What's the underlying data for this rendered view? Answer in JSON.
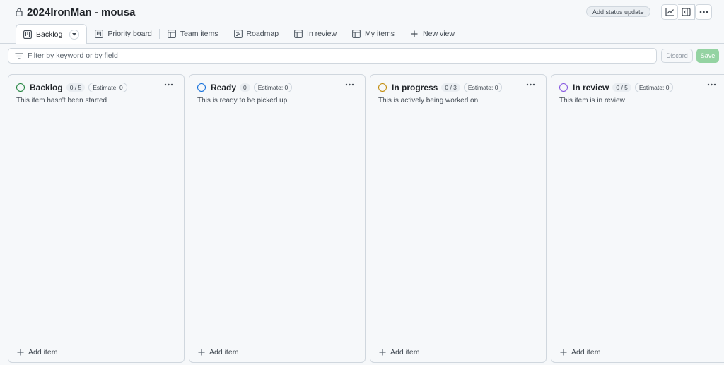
{
  "project": {
    "title": "2024IronMan - mousa"
  },
  "header": {
    "status_update_label": "Add status update",
    "icons": [
      "insights-icon",
      "side-panel-icon",
      "more-options-icon"
    ]
  },
  "tabs": [
    {
      "label": "Backlog",
      "icon": "board-icon",
      "active": true
    },
    {
      "label": "Priority board",
      "icon": "board-icon"
    },
    {
      "label": "Team items",
      "icon": "table-icon"
    },
    {
      "label": "Roadmap",
      "icon": "roadmap-icon"
    },
    {
      "label": "In review",
      "icon": "table-icon"
    },
    {
      "label": "My items",
      "icon": "table-icon"
    },
    {
      "label": "New view",
      "icon": "plus-icon"
    }
  ],
  "filter": {
    "placeholder": "Filter by keyword or by field",
    "discard_label": "Discard",
    "save_label": "Save"
  },
  "columns": [
    {
      "name": "Backlog",
      "count": "0 / 5",
      "estimate": "Estimate: 0",
      "description": "This item hasn't been started",
      "color": "#1a7f37",
      "add_label": "Add item"
    },
    {
      "name": "Ready",
      "count": "0",
      "estimate": "Estimate: 0",
      "description": "This is ready to be picked up",
      "color": "#0969da",
      "add_label": "Add item"
    },
    {
      "name": "In progress",
      "count": "0 / 3",
      "estimate": "Estimate: 0",
      "description": "This is actively being worked on",
      "color": "#bf8700",
      "add_label": "Add item"
    },
    {
      "name": "In review",
      "count": "0 / 5",
      "estimate": "Estimate: 0",
      "description": "This item is in review",
      "color": "#8250df",
      "add_label": "Add item"
    }
  ]
}
